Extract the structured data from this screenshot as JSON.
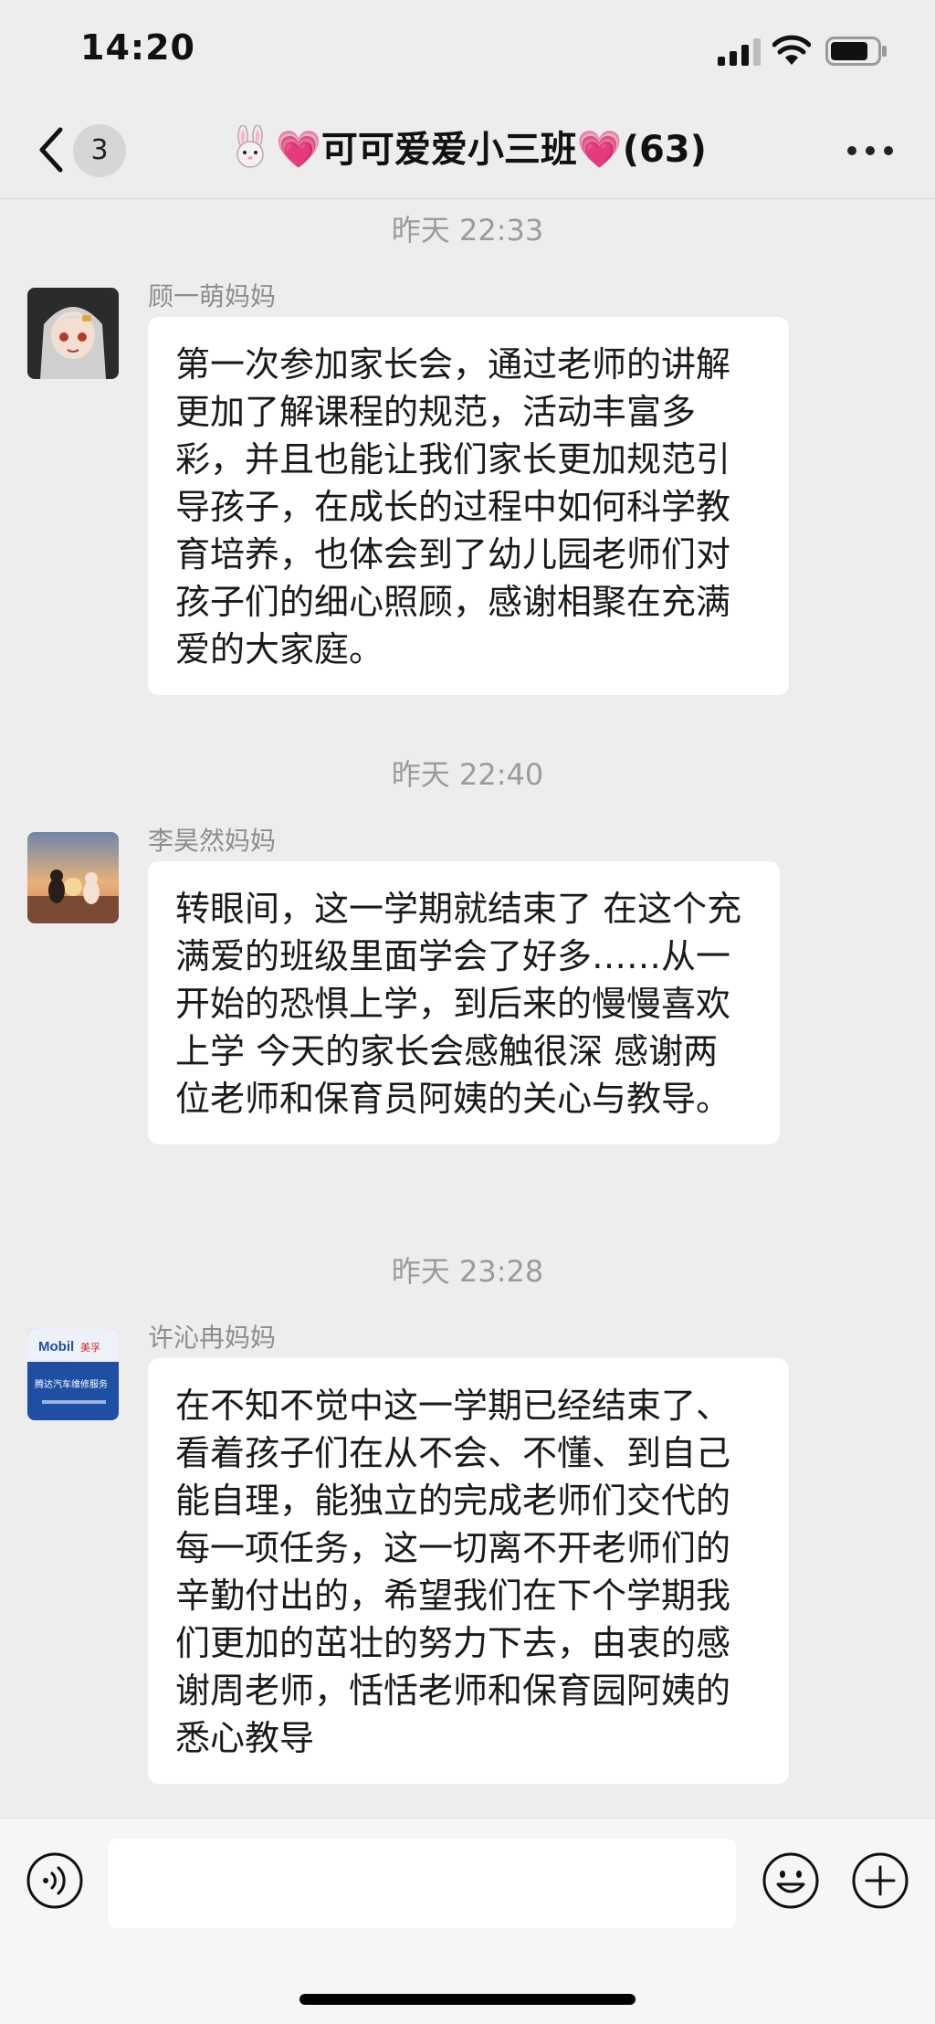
{
  "status": {
    "time": "14:20"
  },
  "header": {
    "back_count": "3",
    "heart_left": "💗",
    "group_name": "可可爱爱小三班",
    "heart_right": "💗",
    "member_count": "(63)"
  },
  "messages": [
    {
      "timestamp": "昨天 22:33",
      "sender": "顾一萌妈妈",
      "text": "第一次参加家长会，通过老师的讲解更加了解课程的规范，活动丰富多彩，并且也能让我们家长更加规范引导孩子，在成长的过程中如何科学教育培养，也体会到了幼儿园老师们对孩子们的细心照顾，感谢相聚在充满爱的大家庭。"
    },
    {
      "timestamp": "昨天 22:40",
      "sender": "李昊然妈妈",
      "text": "转眼间，这一学期就结束了 在这个充满爱的班级里面学会了好多……从一开始的恐惧上学，到后来的慢慢喜欢上学 今天的家长会感触很深 感谢两位老师和保育员阿姨的关心与教导。"
    },
    {
      "timestamp": "昨天 23:28",
      "sender": "许沁冉妈妈",
      "text": "在不知不觉中这一学期已经结束了、看着孩子们在从不会、不懂、到自己能自理，能独立的完成老师们交代的每一项任务，这一切离不开老师们的辛勤付出的，希望我们在下个学期我们更加的茁壮的努力下去，由衷的感谢周老师，恬恬老师和保育园阿姨的悉心教导"
    }
  ],
  "avatar3": {
    "brand": "Mobil",
    "brand_cn": "美孚",
    "shop": "腾达汽车维修服务"
  },
  "icons": {
    "back": "chevron-left-icon",
    "more": "more-dots-icon",
    "voice": "voice-icon",
    "emoji": "emoji-icon",
    "plus": "plus-icon"
  },
  "colors": {
    "background": "#ededed",
    "bubble": "#ffffff",
    "timestamp": "#9b9b9b",
    "heart": "#e23d8f"
  }
}
